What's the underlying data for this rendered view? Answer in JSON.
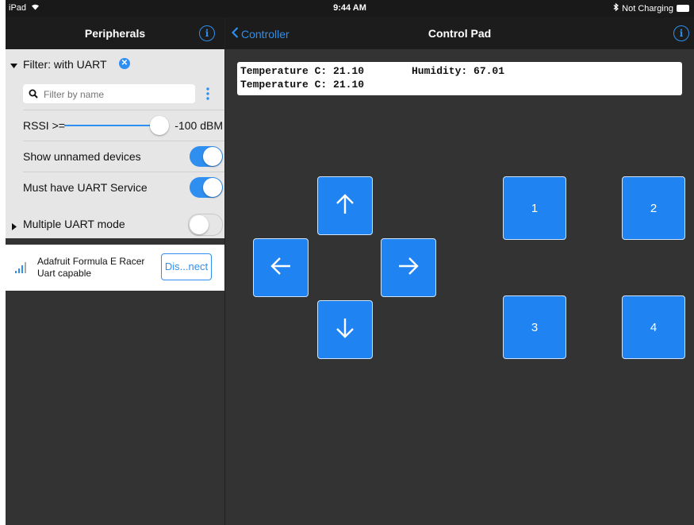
{
  "status_bar": {
    "device": "iPad",
    "time": "9:44 AM",
    "battery_text": "Not Charging"
  },
  "left": {
    "title": "Peripherals",
    "filter": {
      "header": "Filter: with UART",
      "search_placeholder": "Filter by name",
      "rssi_label": "RSSI >=",
      "rssi_value": "-100 dBM",
      "rssi_slider_fraction": 1.0,
      "show_unnamed_label": "Show unnamed devices",
      "show_unnamed_on": true,
      "must_have_uart_label": "Must have UART Service",
      "must_have_uart_on": true
    },
    "multi_uart": {
      "label": "Multiple UART mode",
      "on": false
    },
    "device": {
      "name": "Adafruit Formula E Racer",
      "subtitle": "Uart capable",
      "action": "Dis...nect"
    }
  },
  "right": {
    "back_label": "Controller",
    "title": "Control Pad",
    "console": {
      "line1_temp": "Temperature C: 21.10",
      "line1_hum": "Humidity: 67.01",
      "line2": "Temperature C: 21.10"
    },
    "numbers": [
      "1",
      "2",
      "3",
      "4"
    ]
  },
  "colors": {
    "accent": "#2f8ff0",
    "pad_button": "#1f83f2",
    "background": "#333333"
  }
}
